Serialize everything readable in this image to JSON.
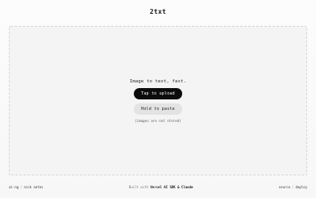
{
  "header": {
    "title": "2txt"
  },
  "dropzone": {
    "tagline": "Image to text, fast.",
    "upload_label": "Tap to upload",
    "paste_label": "Hold to paste",
    "note": "(images are not stored)"
  },
  "footer": {
    "left_link_1": "ai-ng",
    "left_sep": "/",
    "left_link_2": "nick oates",
    "middle_prefix": "Built with",
    "middle_strong": "Vercel AI SDK & Claude",
    "right_link_1": "source",
    "right_sep": "/",
    "right_link_2": "deploy"
  }
}
